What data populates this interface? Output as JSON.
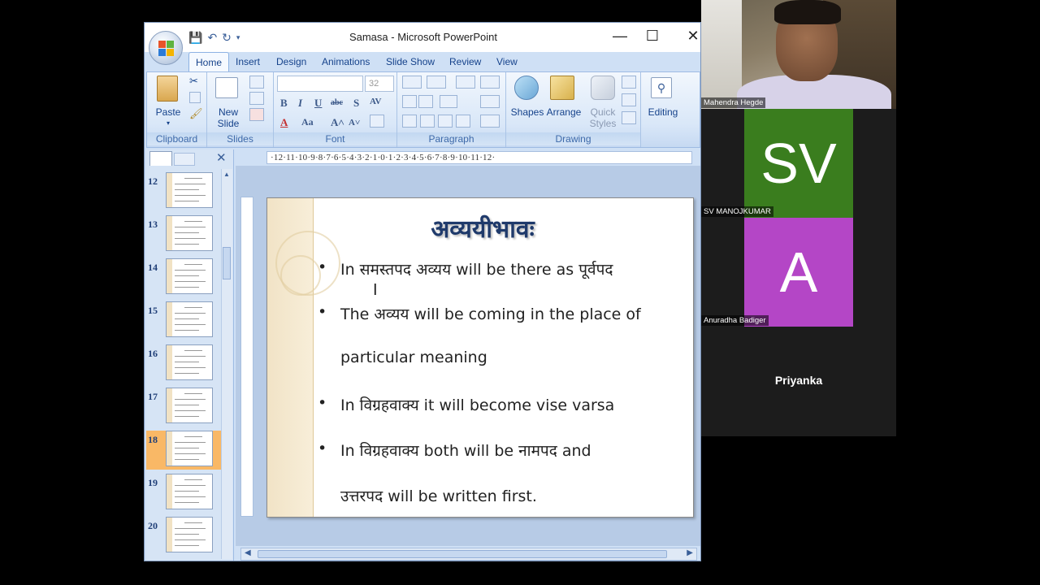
{
  "window": {
    "title": "Samasa - Microsoft PowerPoint",
    "minimize": "—",
    "maximize": "☐",
    "close": "✕"
  },
  "tabs": [
    "Home",
    "Insert",
    "Design",
    "Animations",
    "Slide Show",
    "Review",
    "View"
  ],
  "ribbon": {
    "clipboard": {
      "paste": "Paste",
      "label": "Clipboard"
    },
    "slides": {
      "new_slide": "New Slide",
      "label": "Slides"
    },
    "font": {
      "font_size": "32",
      "label": "Font"
    },
    "paragraph": {
      "label": "Paragraph"
    },
    "drawing": {
      "shapes": "Shapes",
      "arrange": "Arrange",
      "quick_styles": "Quick Styles",
      "label": "Drawing"
    },
    "editing": {
      "label": "Editing"
    }
  },
  "ruler": "·12·11·10·9·8·7·6·5·4·3·2·1·0·1·2·3·4·5·6·7·8·9·10·11·12·",
  "thumbnails": [
    {
      "num": "12",
      "selected": false
    },
    {
      "num": "13",
      "selected": false
    },
    {
      "num": "14",
      "selected": false
    },
    {
      "num": "15",
      "selected": false
    },
    {
      "num": "16",
      "selected": false
    },
    {
      "num": "17",
      "selected": false
    },
    {
      "num": "18",
      "selected": true
    },
    {
      "num": "19",
      "selected": false
    },
    {
      "num": "20",
      "selected": false
    }
  ],
  "slide": {
    "title": "अव्ययीभावः",
    "bullets": [
      "In समस्तपद अव्यय will be there as पूर्वपद",
      "The अव्यय will be coming in the place of",
      "particular meaning",
      "In विग्रहवाक्य  it will become vise varsa",
      "In विग्रहवाक्य both will be नामपद and",
      "उत्तरपद will be written first."
    ]
  },
  "participants": {
    "camera_name": "Mahendra Hegde",
    "sv": {
      "initials": "SV",
      "name": "SV MANOJKUMAR",
      "color": "#3a7d1e"
    },
    "a": {
      "initials": "A",
      "name": "Anuradha Badiger",
      "color": "#b446c6"
    },
    "priyanka": "Priyanka"
  }
}
